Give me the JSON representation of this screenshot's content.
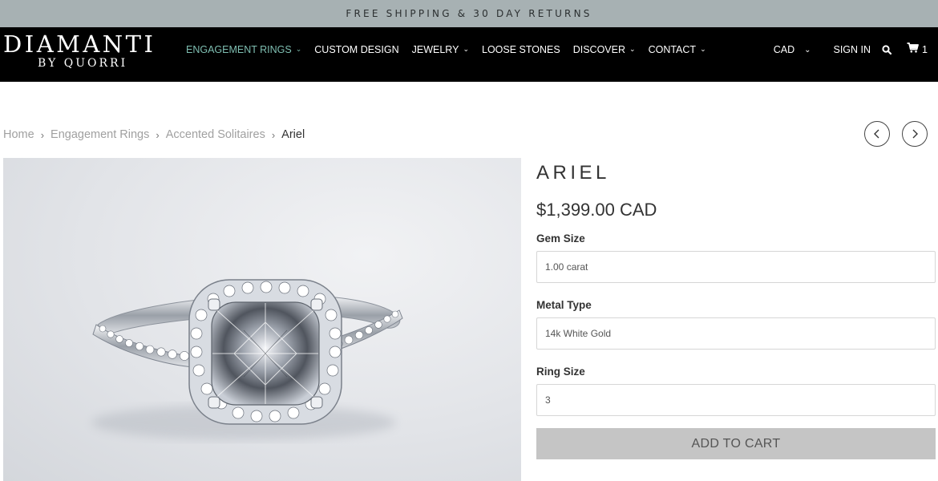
{
  "promo": {
    "text": "FREE SHIPPING & 30 DAY RETURNS"
  },
  "logo": {
    "main": "DIAMANTI",
    "sub": "BY QUORRI"
  },
  "nav": {
    "items": [
      {
        "label": "ENGAGEMENT RINGS",
        "dropdown": true,
        "active": true
      },
      {
        "label": "CUSTOM DESIGN",
        "dropdown": false
      },
      {
        "label": "JEWELRY",
        "dropdown": true
      },
      {
        "label": "LOOSE STONES",
        "dropdown": false
      },
      {
        "label": "DISCOVER",
        "dropdown": true
      },
      {
        "label": "CONTACT",
        "dropdown": true
      }
    ]
  },
  "header_right": {
    "currency": "CAD",
    "sign_in": "SIGN IN",
    "cart_count": "1"
  },
  "breadcrumb": {
    "home": "Home",
    "category": "Engagement Rings",
    "subcategory": "Accented Solitaires",
    "current": "Ariel",
    "separator": "›"
  },
  "product": {
    "title": "ARIEL",
    "price": "$1,399.00 CAD",
    "options": {
      "gem_size": {
        "label": "Gem Size",
        "value": "1.00 carat"
      },
      "metal_type": {
        "label": "Metal Type",
        "value": "14k White Gold"
      },
      "ring_size": {
        "label": "Ring Size",
        "value": "3"
      }
    },
    "add_to_cart": "ADD TO CART"
  },
  "colors": {
    "promo_bg": "#a7b1b3",
    "header_bg": "#000000",
    "nav_active": "#7fbfb2",
    "button_bg": "#c5c5c5"
  },
  "icons": [
    "chevron-down-icon",
    "search-icon",
    "cart-icon",
    "arrow-left-icon",
    "arrow-right-icon"
  ]
}
